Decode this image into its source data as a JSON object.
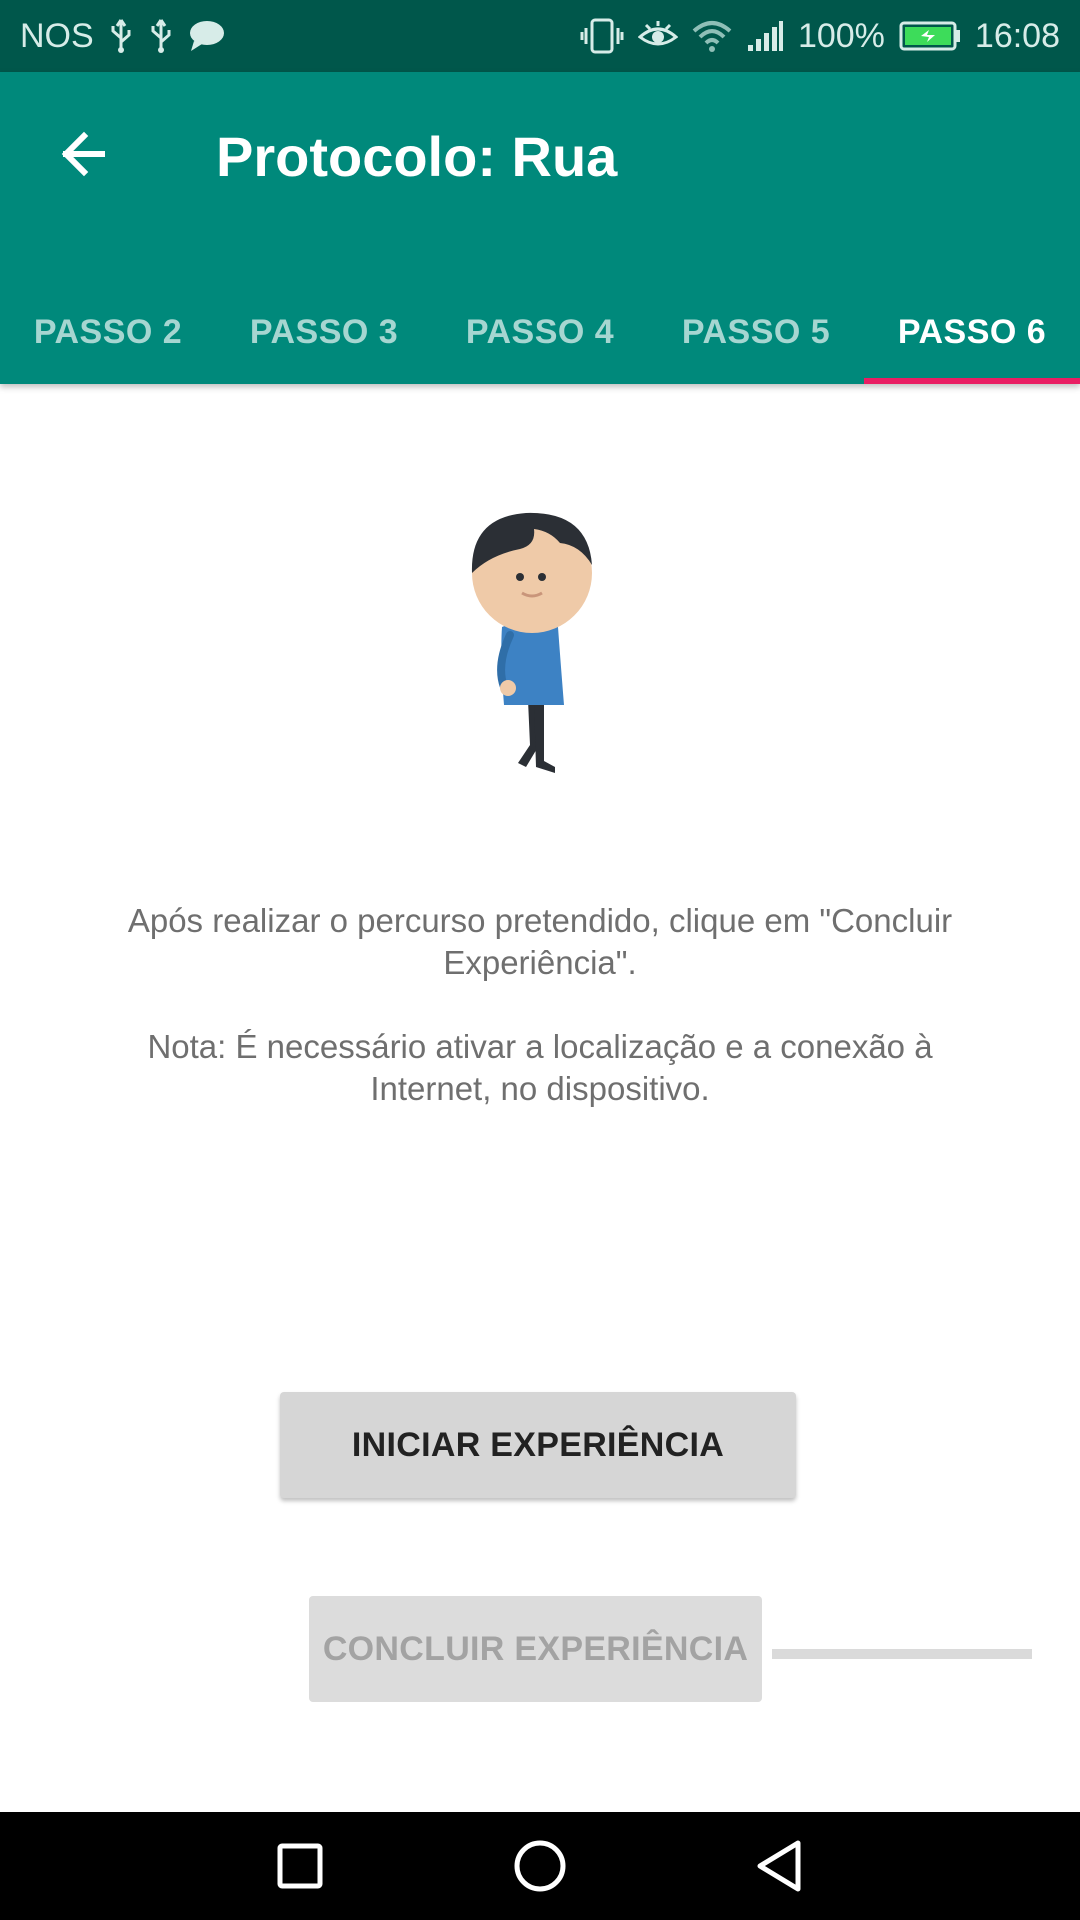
{
  "status_bar": {
    "carrier": "NOS",
    "battery_percent": "100%",
    "time": "16:08",
    "icons": [
      "usb-icon",
      "usb-icon",
      "chat-icon",
      "vibrate-icon",
      "eye-icon",
      "wifi-icon",
      "signal-icon",
      "battery-charging-icon"
    ],
    "background_color": "#00574b"
  },
  "app_bar": {
    "title": "Protocolo: Rua",
    "back_icon": "arrow-back-icon",
    "background_color": "#00897b"
  },
  "tabs": [
    {
      "label": "PASSO 2",
      "active": false
    },
    {
      "label": "PASSO 3",
      "active": false
    },
    {
      "label": "PASSO 4",
      "active": false
    },
    {
      "label": "PASSO 5",
      "active": false
    },
    {
      "label": "PASSO 6",
      "active": true
    }
  ],
  "tab_indicator_color": "#e91e63",
  "content": {
    "illustration": "walking-person-icon",
    "instruction": "Após realizar o percurso pretendido, clique em \"Concluir Experiência\".",
    "note": "Nota: É necessário ativar a localização e a conexão à Internet, no dispositivo."
  },
  "buttons": {
    "start_label": "INICIAR EXPERIÊNCIA",
    "finish_label": "CONCLUIR EXPERIÊNCIA",
    "finish_enabled": false
  },
  "nav_bar": {
    "icons": [
      "recents-square-icon",
      "home-circle-icon",
      "back-triangle-icon"
    ]
  }
}
